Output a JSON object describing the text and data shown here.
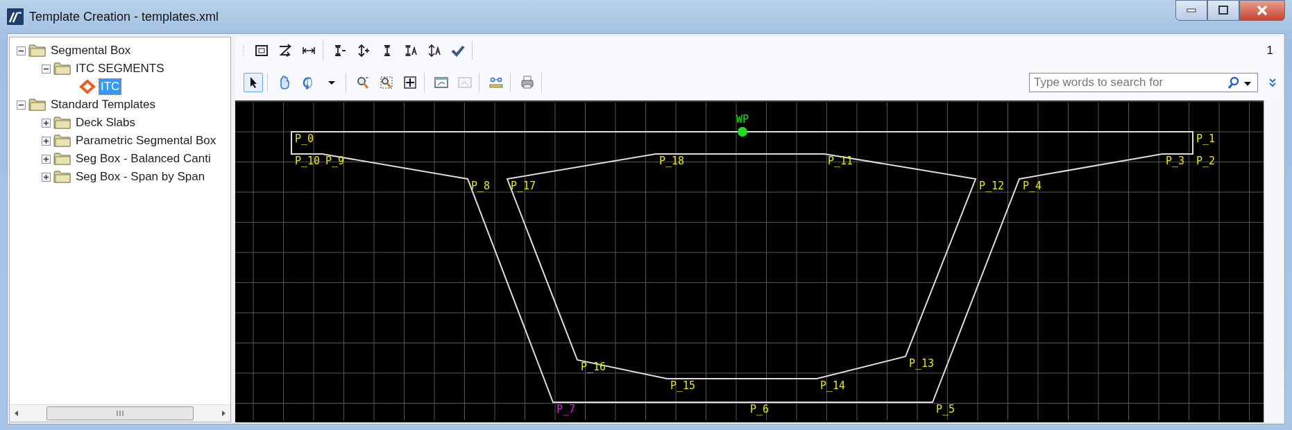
{
  "window": {
    "title": "Template Creation - templates.xml"
  },
  "tree": {
    "items": [
      {
        "label": "Segmental Box",
        "kind": "folder",
        "expanded": true,
        "selected": false,
        "children": [
          {
            "label": "ITC SEGMENTS",
            "kind": "folder",
            "expanded": true,
            "selected": false,
            "children": [
              {
                "label": "ITC",
                "kind": "template",
                "selected": true
              }
            ]
          }
        ]
      },
      {
        "label": "Standard Templates",
        "kind": "folder",
        "expanded": true,
        "selected": false,
        "children": [
          {
            "label": "Deck Slabs",
            "kind": "folder",
            "expanded": false,
            "selected": false
          },
          {
            "label": "Parametric Segmental Box",
            "kind": "folder",
            "expanded": false,
            "selected": false
          },
          {
            "label": "Seg Box - Balanced Canti",
            "kind": "folder",
            "expanded": false,
            "selected": false
          },
          {
            "label": "Seg Box - Span by Span",
            "kind": "folder",
            "expanded": false,
            "selected": false
          }
        ]
      }
    ]
  },
  "toolbar_top": {
    "groups": [
      [
        {
          "kind": "frame"
        },
        {
          "kind": "route"
        },
        {
          "kind": "hdim"
        }
      ],
      [
        {
          "kind": "vminus"
        },
        {
          "kind": "vplus"
        },
        {
          "kind": "vdim"
        },
        {
          "kind": "va"
        },
        {
          "kind": "va2"
        },
        {
          "kind": "check"
        }
      ]
    ],
    "counter": "1"
  },
  "toolbar_view": {
    "groups": [
      [
        {
          "kind": "select",
          "selected": true,
          "disabled": false
        }
      ],
      [
        {
          "kind": "pan",
          "selected": false,
          "disabled": false
        },
        {
          "kind": "rotate",
          "selected": false,
          "disabled": false
        },
        {
          "kind": "caret",
          "selected": false,
          "disabled": false
        }
      ],
      [
        {
          "kind": "zoom",
          "selected": false,
          "disabled": false
        },
        {
          "kind": "zoomwin",
          "selected": false,
          "disabled": false
        },
        {
          "kind": "fit",
          "selected": false,
          "disabled": false
        }
      ],
      [
        {
          "kind": "prev",
          "selected": false,
          "disabled": false
        },
        {
          "kind": "next",
          "selected": false,
          "disabled": true
        }
      ],
      [
        {
          "kind": "measure",
          "selected": false,
          "disabled": false
        }
      ],
      [
        {
          "kind": "print",
          "selected": false,
          "disabled": false
        }
      ]
    ],
    "search": {
      "placeholder": "Type words to search for"
    }
  },
  "canvas": {
    "points": [
      {
        "label": "WP",
        "kind": "origin",
        "selected": false
      },
      {
        "label": "P_0",
        "kind": "point",
        "selected": false
      },
      {
        "label": "P_1",
        "kind": "point",
        "selected": false
      },
      {
        "label": "P_10",
        "kind": "point",
        "selected": false
      },
      {
        "label": "P_9",
        "kind": "point",
        "selected": false
      },
      {
        "label": "P_18",
        "kind": "point",
        "selected": false
      },
      {
        "label": "P_11",
        "kind": "point",
        "selected": false
      },
      {
        "label": "P_3",
        "kind": "point",
        "selected": false
      },
      {
        "label": "P_2",
        "kind": "point",
        "selected": false
      },
      {
        "label": "P_8",
        "kind": "point",
        "selected": false
      },
      {
        "label": "P_17",
        "kind": "point",
        "selected": false
      },
      {
        "label": "P_12",
        "kind": "point",
        "selected": false
      },
      {
        "label": "P_4",
        "kind": "point",
        "selected": false
      },
      {
        "label": "P_16",
        "kind": "point",
        "selected": false
      },
      {
        "label": "P_13",
        "kind": "point",
        "selected": false
      },
      {
        "label": "P_15",
        "kind": "point",
        "selected": false
      },
      {
        "label": "P_14",
        "kind": "point",
        "selected": false
      },
      {
        "label": "P_7",
        "kind": "point",
        "selected": true
      },
      {
        "label": "P_6",
        "kind": "point",
        "selected": false
      },
      {
        "label": "P_5",
        "kind": "point",
        "selected": false
      }
    ]
  }
}
